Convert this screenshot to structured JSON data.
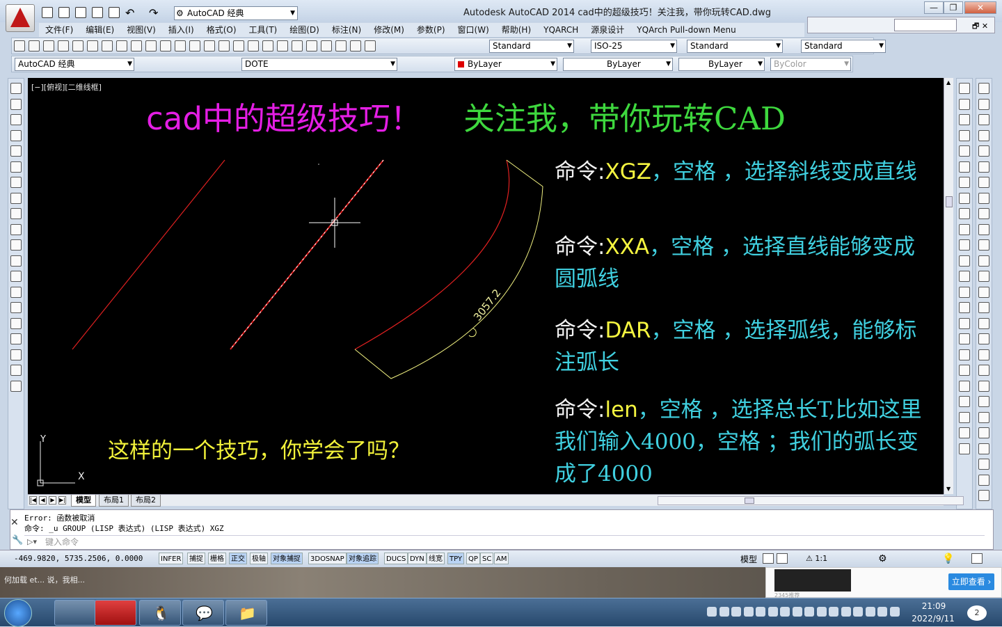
{
  "app": {
    "title": "Autodesk AutoCAD 2014      cad中的超级技巧！关注我，带你玩转CAD.dwg",
    "workspace": "AutoCAD 经典"
  },
  "menubar": [
    "文件(F)",
    "编辑(E)",
    "视图(V)",
    "插入(I)",
    "格式(O)",
    "工具(T)",
    "绘图(D)",
    "标注(N)",
    "修改(M)",
    "参数(P)",
    "窗口(W)",
    "帮助(H)",
    "YQARCH",
    "源泉设计",
    "YQArch Pull-down Menu"
  ],
  "styles": {
    "text_style": "Standard",
    "dim_style": "ISO-25",
    "table_style": "Standard",
    "multileader_style": "Standard"
  },
  "layers": {
    "workspace": "AutoCAD 经典",
    "current_layer": "DOTE",
    "color": "ByLayer",
    "linetype": "ByLayer",
    "lineweight": "ByLayer",
    "plot_style": "ByColor"
  },
  "canvas": {
    "viewport_label": "[−][俯视][二维线框]",
    "headline_a": "cad中的超级技巧！",
    "headline_b": "关注我，带你玩转CAD",
    "dimension_text": "3057.2",
    "question": "这样的一个技巧，你学会了吗？",
    "ucs_x": "X",
    "ucs_y": "Y",
    "commands": [
      {
        "prefix": "命令:",
        "cmd": "XGZ",
        "rest": "，空格 ，选择斜线变成直线"
      },
      {
        "prefix": "命令:",
        "cmd": "XXA",
        "rest": "，空格 ，选择直线能够变成圆弧线"
      },
      {
        "prefix": "命令:",
        "cmd": "DAR",
        "rest": "，空格 ，选择弧线，能够标注弧长"
      },
      {
        "prefix": "命令:",
        "cmd": "len",
        "rest": "，空格 ，选择总长T,比如这里我们输入4000，空格 ；我们的弧长变成了4000"
      }
    ],
    "colors": {
      "background": "#000000",
      "red_line": "#e02020",
      "yellow_arc": "#f0f080",
      "cyan_text": "#40d0e0"
    }
  },
  "tabs": [
    "模型",
    "布局1",
    "布局2"
  ],
  "command_line": {
    "history": [
      "Error: 函数被取消",
      "命令: _u GROUP (LISP 表达式) (LISP 表达式) XGZ"
    ],
    "placeholder": "键入命令"
  },
  "status": {
    "coords": "-469.9820,  5735.2506, 0.0000",
    "toggles": [
      {
        "label": "INFER",
        "on": false
      },
      {
        "label": "捕捉",
        "on": false
      },
      {
        "label": "栅格",
        "on": false
      },
      {
        "label": "正交",
        "on": true
      },
      {
        "label": "极轴",
        "on": false
      },
      {
        "label": "对象捕捉",
        "on": true
      },
      {
        "label": "3DOSNAP",
        "on": false
      },
      {
        "label": "对象追踪",
        "on": true
      },
      {
        "label": "DUCS",
        "on": false
      },
      {
        "label": "DYN",
        "on": false
      },
      {
        "label": "线宽",
        "on": false
      },
      {
        "label": "TPY",
        "on": true
      },
      {
        "label": "QP",
        "on": false
      },
      {
        "label": "SC",
        "on": false
      },
      {
        "label": "AM",
        "on": false
      }
    ],
    "model": "模型",
    "scale": "1:1"
  },
  "desktop": {
    "text": "何加载 et...     说，我相...",
    "ad_button": "立即查看 ›",
    "ad_caption": "2345推荐"
  },
  "taskbar": {
    "time": "21:09",
    "date": "2022/9/11"
  }
}
